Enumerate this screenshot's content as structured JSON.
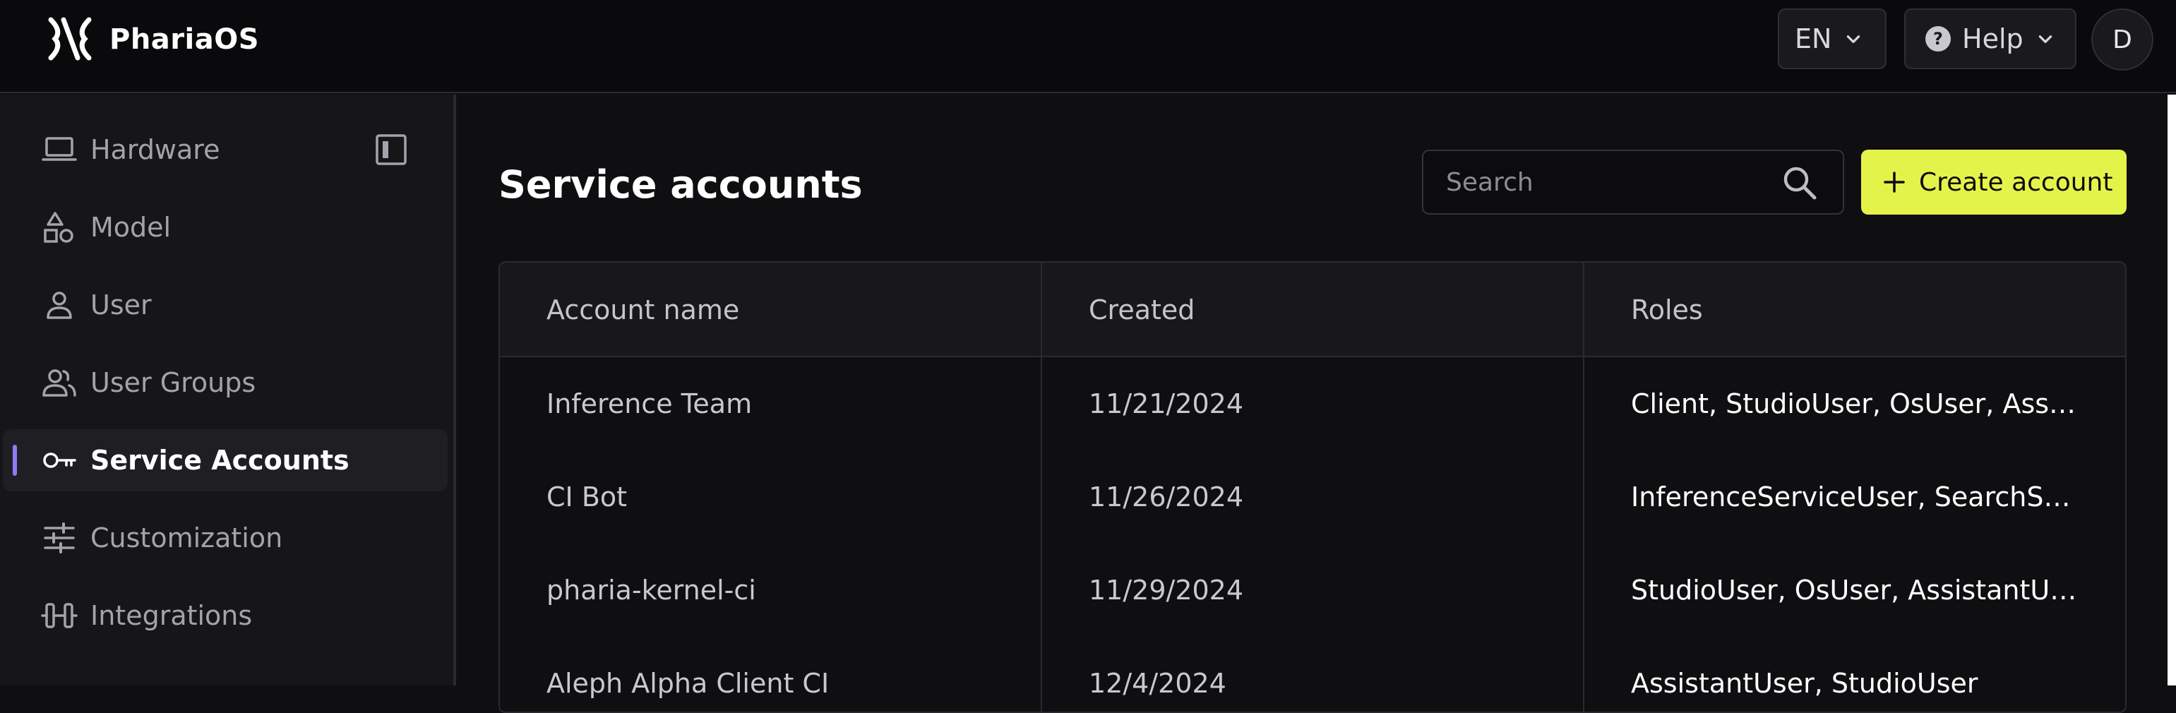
{
  "header": {
    "brand": "PhariaOS",
    "language": "EN",
    "help_label": "Help",
    "avatar_initial": "D"
  },
  "sidebar": {
    "items": [
      {
        "label": "Hardware",
        "icon": "laptop-icon"
      },
      {
        "label": "Model",
        "icon": "shapes-icon"
      },
      {
        "label": "User",
        "icon": "user-icon"
      },
      {
        "label": "User Groups",
        "icon": "users-icon"
      },
      {
        "label": "Service Accounts",
        "icon": "key-icon",
        "active": true
      },
      {
        "label": "Customization",
        "icon": "sliders-icon"
      },
      {
        "label": "Integrations",
        "icon": "plug-icon"
      }
    ]
  },
  "main": {
    "title": "Service accounts",
    "search_placeholder": "Search",
    "create_label": "Create account",
    "table": {
      "columns": [
        "Account name",
        "Created",
        "Roles"
      ],
      "rows": [
        {
          "name": "Inference Team",
          "created": "11/21/2024",
          "roles": "Client, StudioUser, OsUser, AssistantUser"
        },
        {
          "name": "CI Bot",
          "created": "11/26/2024",
          "roles": "InferenceServiceUser, SearchServiceUser"
        },
        {
          "name": "pharia-kernel-ci",
          "created": "11/29/2024",
          "roles": "StudioUser, OsUser, AssistantUser, Client"
        },
        {
          "name": "Aleph Alpha Client CI",
          "created": "12/4/2024",
          "roles": "AssistantUser, StudioUser"
        }
      ]
    }
  },
  "colors": {
    "accent": "#e4f34a",
    "active_indicator": "#8b7cf6",
    "background": "#0f0f11",
    "sidebar": "#161618"
  }
}
